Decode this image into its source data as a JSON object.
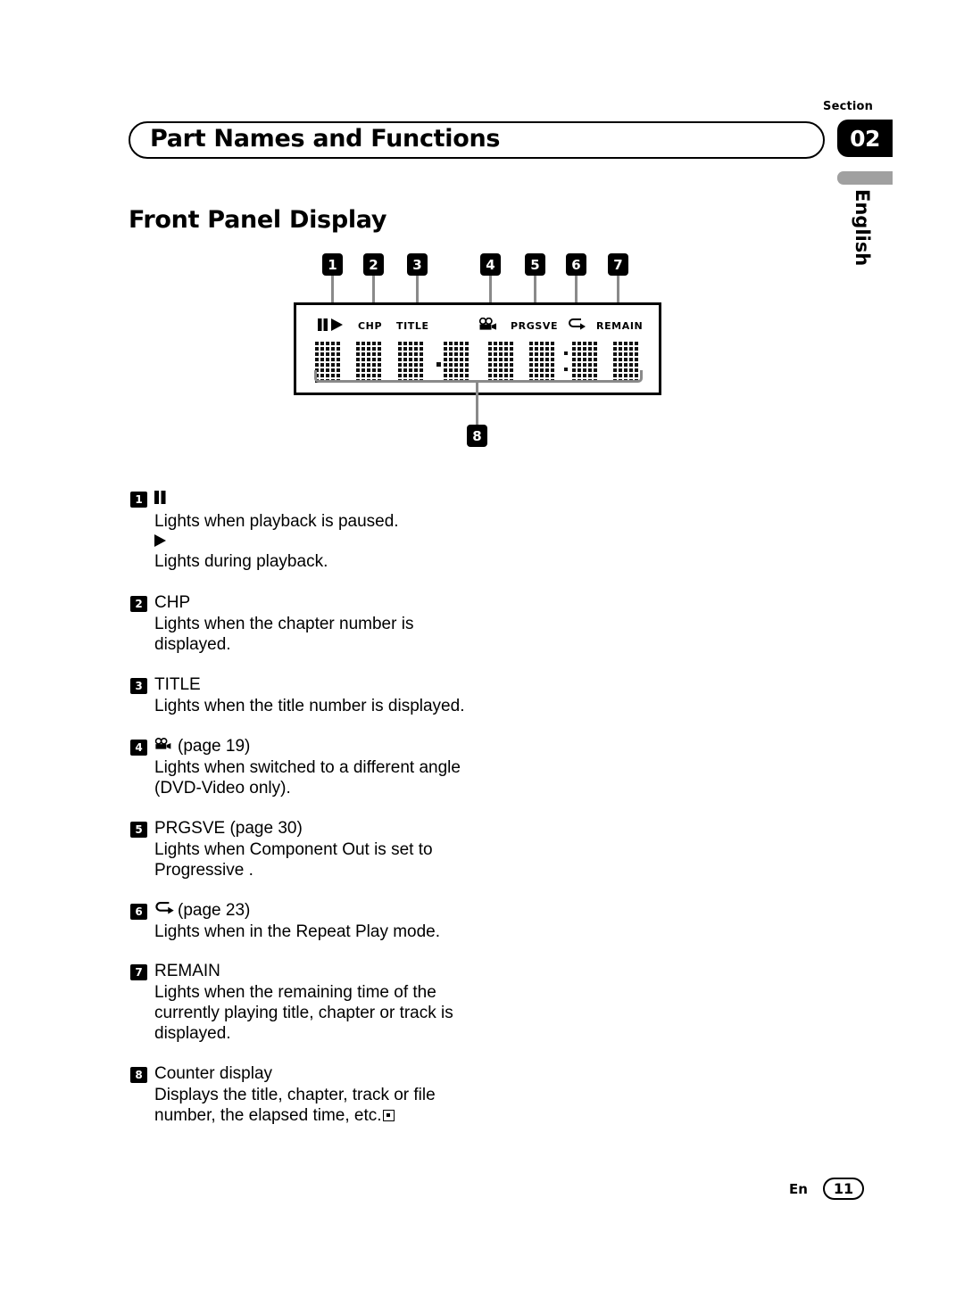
{
  "header": {
    "section_label": "Section",
    "section_number": "02",
    "language": "English",
    "chapter_title": "Part Names and Functions",
    "page_heading": "Front Panel Display"
  },
  "diagram": {
    "name": "front-panel-display",
    "callouts": [
      "1",
      "2",
      "3",
      "4",
      "5",
      "6",
      "7"
    ],
    "counter_callout": "8",
    "indicators": [
      {
        "id": "1",
        "label": "❚❚▶",
        "kind": "pause-play-icon"
      },
      {
        "id": "2",
        "label": "CHP",
        "kind": "text"
      },
      {
        "id": "3",
        "label": "TITLE",
        "kind": "text"
      },
      {
        "id": "4",
        "label": "angle-camera-icon",
        "kind": "icon"
      },
      {
        "id": "5",
        "label": "PRGSVE",
        "kind": "text"
      },
      {
        "id": "6",
        "label": "repeat-loop-icon",
        "kind": "icon"
      },
      {
        "id": "7",
        "label": "REMAIN",
        "kind": "text"
      }
    ],
    "digit_count": 8,
    "separator_dot": "·",
    "separator_colon": ":"
  },
  "items": [
    {
      "num": "1",
      "head_icon": "pause-icon",
      "head": "❚❚",
      "body": "Lights when playback is paused.",
      "head2_icon": "play-icon",
      "head2": "▶",
      "body2": "Lights during playback."
    },
    {
      "num": "2",
      "head": "CHP",
      "body": "Lights when the chapter number is displayed."
    },
    {
      "num": "3",
      "head": "TITLE",
      "body": "Lights when the title number is displayed."
    },
    {
      "num": "4",
      "head_icon": "angle-camera-icon",
      "head": "(page 19)",
      "body": "Lights when switched to a different angle (DVD-Video only)."
    },
    {
      "num": "5",
      "head": "PRGSVE (page 30)",
      "body": "Lights when Component Out  is set to Progressive ."
    },
    {
      "num": "6",
      "head_icon": "repeat-loop-icon",
      "head": "(page 23)",
      "body": "Lights when in the Repeat Play mode."
    },
    {
      "num": "7",
      "head": "REMAIN",
      "body": "Lights when the remaining time of the currently playing title, chapter or track is displayed."
    },
    {
      "num": "8",
      "head": "Counter display",
      "body": "Displays the title, chapter, track or file number, the elapsed time, etc."
    }
  ],
  "footer": {
    "language_code": "En",
    "page_number": "11"
  },
  "colors": {
    "ink": "#000000",
    "leader": "#8a8a8a",
    "gray_tab": "#a0a0a0",
    "paper": "#ffffff"
  }
}
